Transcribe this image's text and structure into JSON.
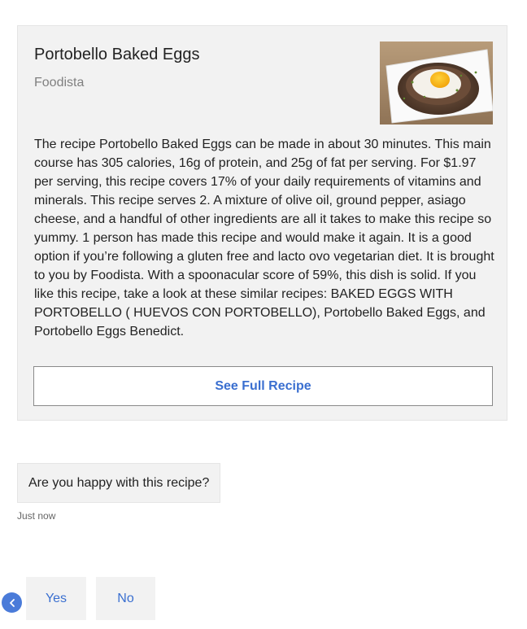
{
  "recipe_card": {
    "title": "Portobello Baked Eggs",
    "source": "Foodista",
    "image_icon": "baked-egg-in-mushroom-photo",
    "description": "The recipe Portobello Baked Eggs can be made in about 30 minutes. This main course has 305 calories, 16g of protein, and 25g of fat per serving. For $1.97 per serving, this recipe covers 17% of your daily requirements of vitamins and minerals. This recipe serves 2. A mixture of olive oil, ground pepper, asiago cheese, and a handful of other ingredients are all it takes to make this recipe so yummy. 1 person has made this recipe and would make it again. It is a good option if you’re following a gluten free and lacto ovo vegetarian diet. It is brought to you by Foodista. With a spoonacular score of 59%, this dish is solid. If you like this recipe, take a look at these similar recipes: BAKED EGGS WITH PORTOBELLO ( HUEVOS CON PORTOBELLO), Portobello Baked Eggs, and Portobello Eggs Benedict.",
    "button_label": "See Full Recipe"
  },
  "message": {
    "text": "Are you happy with this recipe?",
    "timestamp": "Just now"
  },
  "actions": {
    "back_icon": "chevron-left-icon",
    "yes_label": "Yes",
    "no_label": "No"
  },
  "colors": {
    "accent": "#3a6fd0",
    "card_bg": "#f2f2f2",
    "back_button": "#4a7bd9"
  }
}
